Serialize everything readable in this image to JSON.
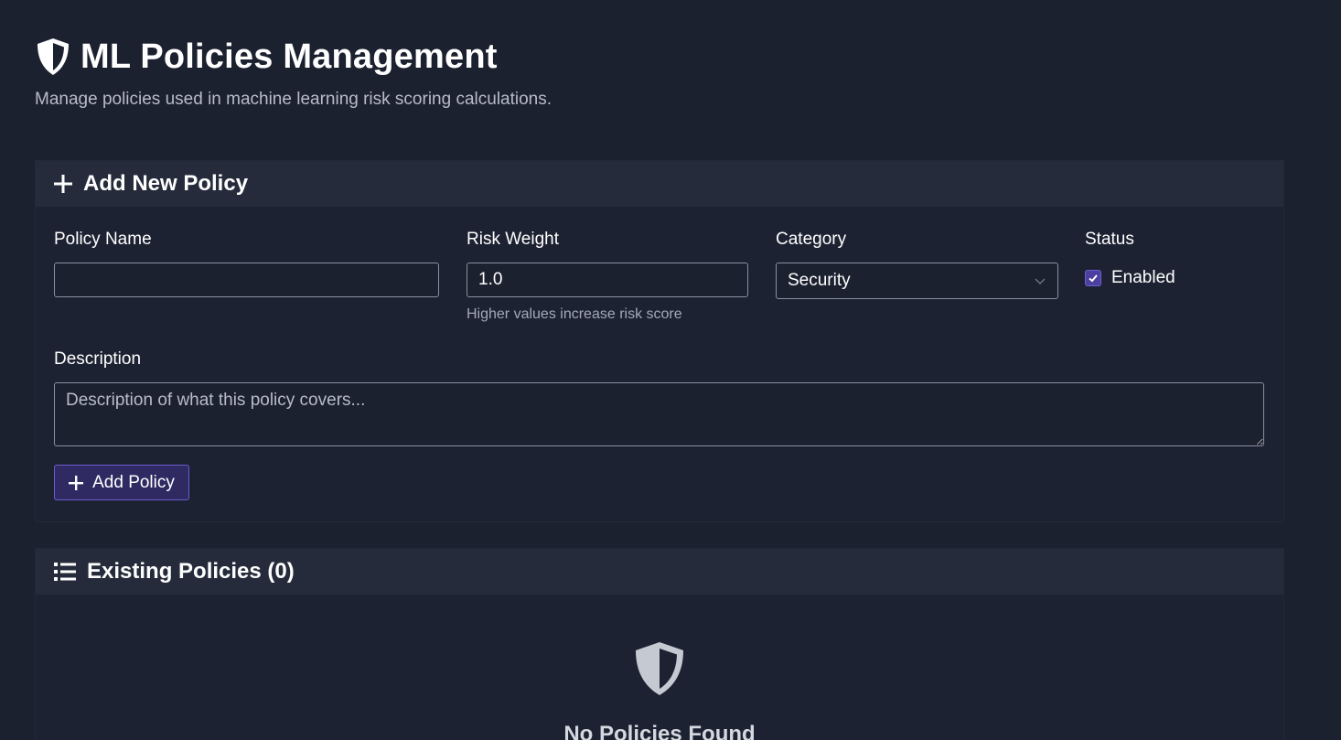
{
  "header": {
    "title": "ML Policies Management",
    "subtitle": "Manage policies used in machine learning risk scoring calculations.",
    "icon": "shield-icon"
  },
  "add_form": {
    "title": "Add New Policy",
    "icon": "plus-icon",
    "policy_name": {
      "label": "Policy Name",
      "value": "",
      "placeholder": ""
    },
    "risk_weight": {
      "label": "Risk Weight",
      "value": "1.0",
      "hint": "Higher values increase risk score"
    },
    "category": {
      "label": "Category",
      "selected": "Security"
    },
    "status": {
      "label": "Status",
      "checkbox_label": "Enabled",
      "checked": true
    },
    "description": {
      "label": "Description",
      "placeholder": "Description of what this policy covers..."
    },
    "submit_label": "Add Policy"
  },
  "existing": {
    "title": "Existing Policies (0)",
    "icon": "list-icon",
    "empty_icon": "shield-icon",
    "empty_title": "No Policies Found"
  },
  "colors": {
    "background": "#1c2130",
    "card_header": "#252b3a",
    "accent": "#4b3f9f",
    "accent_border": "#6a5ccc"
  }
}
